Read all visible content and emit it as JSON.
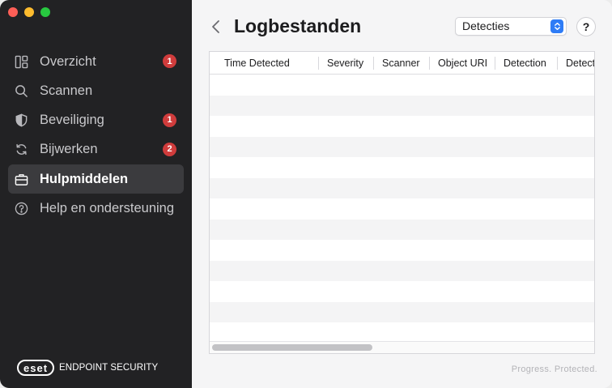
{
  "sidebar": {
    "items": [
      {
        "label": "Overzicht",
        "icon": "dashboard-icon",
        "badge": "1"
      },
      {
        "label": "Scannen",
        "icon": "search-icon",
        "badge": ""
      },
      {
        "label": "Beveiliging",
        "icon": "shield-icon",
        "badge": "1"
      },
      {
        "label": "Bijwerken",
        "icon": "refresh-icon",
        "badge": "2"
      },
      {
        "label": "Hulpmiddelen",
        "icon": "briefcase-icon",
        "badge": "",
        "active": true
      },
      {
        "label": "Help en ondersteuning",
        "icon": "help-circle-icon",
        "badge": ""
      }
    ],
    "brand_logo": "eset",
    "brand_product": "ENDPOINT SECURITY"
  },
  "header": {
    "title": "Logbestanden",
    "log_type_selected": "Detecties",
    "help_label": "?"
  },
  "table": {
    "columns": [
      "Time Detected",
      "Severity",
      "Scanner",
      "Object URI",
      "Detection",
      "Detect"
    ],
    "rows": []
  },
  "footer": {
    "tagline": "Progress. Protected."
  },
  "colors": {
    "sidebar_bg": "#222224",
    "active_item_bg": "#3b3b3e",
    "badge_red": "#d03c3c",
    "accent_blue": "#2e7cf6"
  }
}
